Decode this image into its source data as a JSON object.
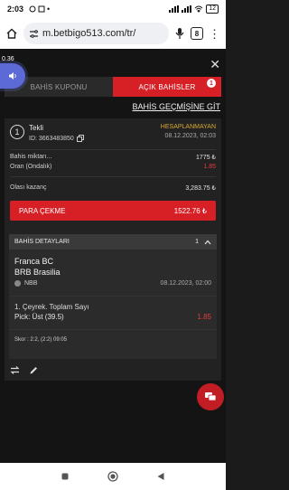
{
  "status_bar": {
    "time": "2:03",
    "battery": "12"
  },
  "browser": {
    "url": "m.betbigo513.com/tr/",
    "tab_count": "8"
  },
  "overlay": {
    "speed": "0.36",
    "close_icon": "close-icon"
  },
  "tabs": [
    {
      "label": "BAHİS KUPONU"
    },
    {
      "label": "AÇIK BAHİSLER",
      "badge": "1"
    }
  ],
  "history_link": "BAHİS GEÇMİŞİNE GİT",
  "bet": {
    "index": "1",
    "type": "Tekli",
    "id": "ID: 3663483850",
    "status": "HESAPLANMAYAN",
    "date": "08.12.2023, 02:03",
    "stake_label": "Bahis miktarı...",
    "stake_value": "1775 ₺",
    "odds_label": "Oran (Ondalık)",
    "odds_value": "1.85",
    "potential_label": "Olası kazanç",
    "potential_value": "3,283.75 ₺",
    "cashout_label": "PARA ÇEKME",
    "cashout_value": "1522.76 ₺"
  },
  "details": {
    "title": "BAHİS DETAYLARI",
    "count": "1",
    "team_home": "Franca BC",
    "team_away": "BRB Brasilia",
    "league": "NBB",
    "match_date": "08.12.2023, 02:00",
    "market": "1. Çeyrek. Toplam Sayı",
    "pick": "Pick: Üst (39.5)",
    "pick_odds": "1.85",
    "score": "Skor : 2:2, (2:2) 09:05"
  }
}
